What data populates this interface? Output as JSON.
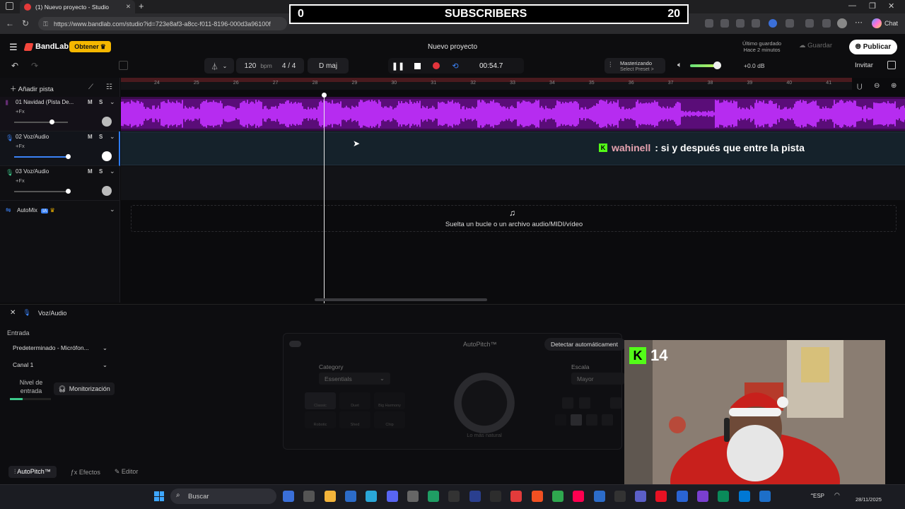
{
  "browser": {
    "tab_title": "(1) Nuevo proyecto - Studio",
    "url": "https://www.bandlab.com/studio?id=723e8af3-a8cc-f011-8196-000d3a96100f",
    "chat_label": "Chat"
  },
  "overlay": {
    "subs_current": "0",
    "subs_label": "SUBSCRIBERS",
    "subs_goal": "20"
  },
  "app": {
    "brand": "BandLab",
    "obtener_label": "Obtener",
    "project_title": "Nuevo proyecto",
    "saved_line1": "Último guardado",
    "saved_line2": "Hace 2 minutos",
    "guardar_label": "Guardar",
    "publicar_label": "Publicar",
    "invitar_label": "Invitar"
  },
  "transport": {
    "tempo": "120",
    "tempo_unit": "bpm",
    "time_signature": "4 / 4",
    "key": "D maj",
    "time": "00:54.7",
    "mastering_title": "Masterizando",
    "mastering_preset": "Select Preset >",
    "volume_db": "+0.0 dB"
  },
  "tracks": {
    "add_label": "Añadir pista",
    "items": [
      {
        "name": "01  Navidad (Pista De...",
        "fx": "+Fx"
      },
      {
        "name": "02  Voz/Audio",
        "fx": "+Fx"
      },
      {
        "name": "03  Voz/Audio",
        "fx": "+Fx"
      }
    ],
    "mute": "M",
    "solo": "S",
    "automix": "AutoMix",
    "ia_badge": "IA"
  },
  "ruler": {
    "labels": [
      "24",
      "25",
      "26",
      "27",
      "28",
      "29",
      "30",
      "31",
      "32",
      "33",
      "34",
      "35",
      "36",
      "37",
      "38",
      "39",
      "40",
      "41"
    ]
  },
  "timeline": {
    "drop_text": "Suelta un bucle o un archivo audio/MIDI/vídeo"
  },
  "chat_overlay": {
    "user": "wahinell",
    "message": ": si y después que entre la pista"
  },
  "panel": {
    "track_title": "Voz/Audio",
    "entrada_label": "Entrada",
    "input_device": "Predeterminado - Micrófon...",
    "channel": "Canal 1",
    "nivel_label": "Nivel de entrada",
    "monitor_label": "Monitorización",
    "autopitch_title": "AutoPitch™",
    "detect_label": "Detectar automáticament",
    "category_label": "Category",
    "category_value": "Essentials",
    "escala_label": "Escala",
    "escala_value": "Mayor",
    "knob_caption": "Lo más natural",
    "effects": [
      "Classic",
      "Duet",
      "Big Harmony",
      "Robotic",
      "Shed",
      "Chip"
    ],
    "tabs": [
      "AutoPitch™",
      "Efectos",
      "Editor"
    ]
  },
  "webcam": {
    "kick_count": "14"
  },
  "taskbar": {
    "search_placeholder": "Buscar",
    "lang": "ESP",
    "date": "28/11/2025"
  }
}
